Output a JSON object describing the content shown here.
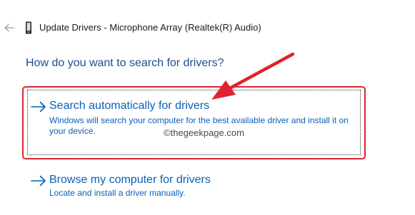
{
  "window": {
    "title": "Update Drivers - Microphone Array (Realtek(R) Audio)",
    "back_icon": "arrow-left-icon",
    "device_icon": "device-icon"
  },
  "heading": "How do you want to search for drivers?",
  "options": [
    {
      "icon": "arrow-right-icon",
      "title": "Search automatically for drivers",
      "description": "Windows will search your computer for the best available driver and install it on your device.",
      "highlighted": true
    },
    {
      "icon": "arrow-right-icon",
      "title": "Browse my computer for drivers",
      "description": "Locate and install a driver manually.",
      "highlighted": false
    }
  ],
  "watermark": "©thegeekpage.com",
  "colors": {
    "heading": "#1e4e8c",
    "link": "#0b5fb8",
    "highlight": "#e0232f",
    "annotation_arrow": "#e0232f"
  }
}
